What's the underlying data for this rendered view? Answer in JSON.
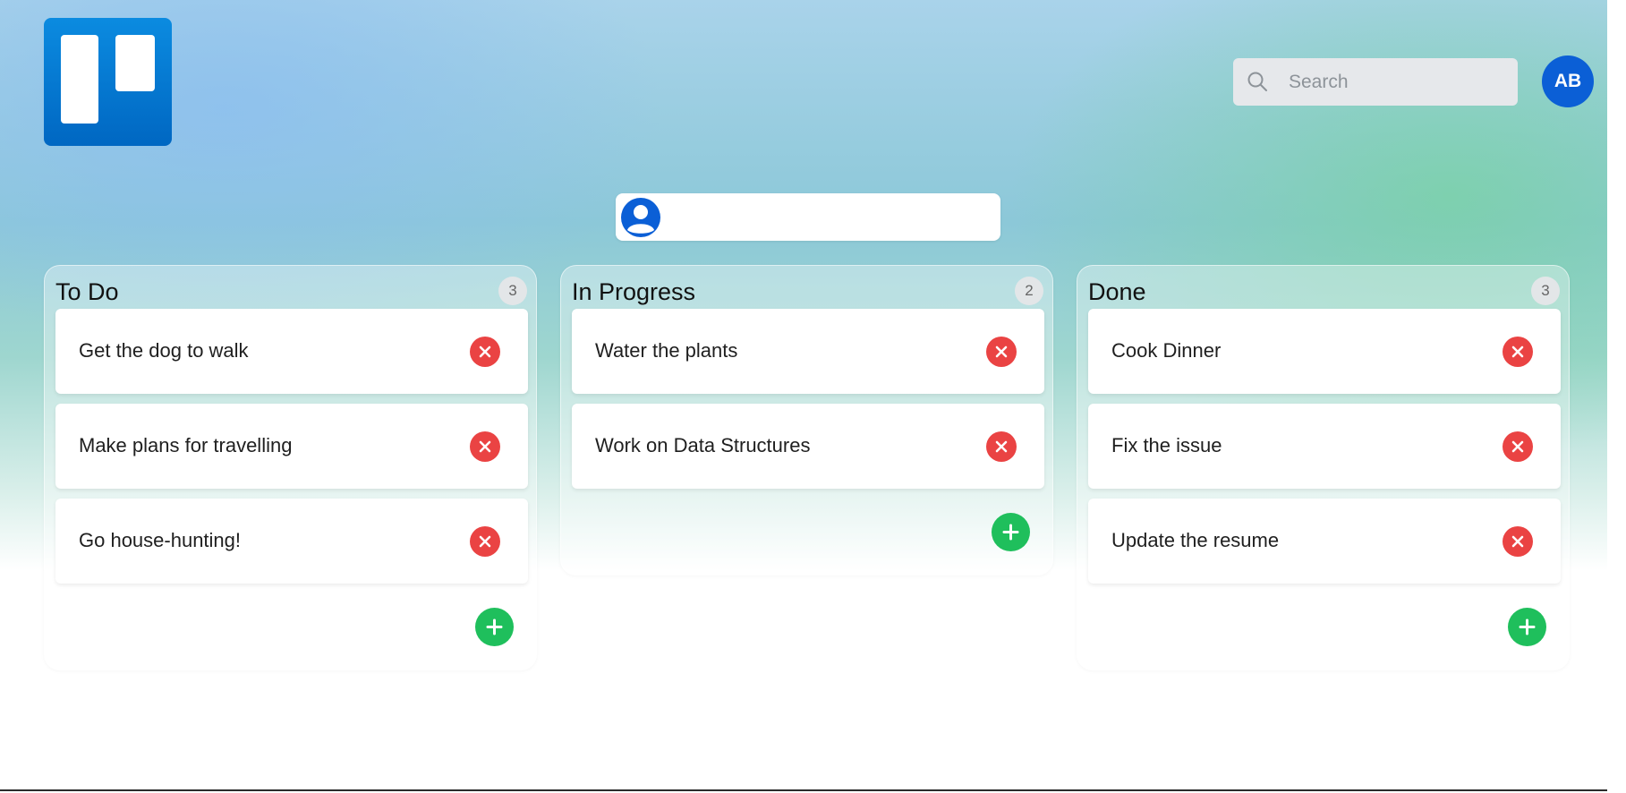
{
  "app": {
    "logo_icon": "trello-logo-icon"
  },
  "header": {
    "search": {
      "placeholder": "Search",
      "value": "",
      "icon": "search-icon"
    },
    "avatar_initials": "AB"
  },
  "board": {
    "name": "",
    "user_icon": "user-circle-icon"
  },
  "columns": [
    {
      "title": "To Do",
      "count": "3",
      "cards": [
        {
          "text": "Get the dog to walk"
        },
        {
          "text": "Make plans for travelling"
        },
        {
          "text": "Go house-hunting!"
        }
      ]
    },
    {
      "title": "In Progress",
      "count": "2",
      "cards": [
        {
          "text": "Water the plants"
        },
        {
          "text": "Work on Data Structures"
        }
      ]
    },
    {
      "title": "Done",
      "count": "3",
      "cards": [
        {
          "text": "Cook Dinner"
        },
        {
          "text": "Fix the issue"
        },
        {
          "text": "Update the resume"
        }
      ]
    }
  ],
  "colors": {
    "logo_blue": "#0079bf",
    "avatar_blue": "#0b5fd6",
    "delete_red": "#ea4343",
    "add_green": "#1fbf5c"
  }
}
